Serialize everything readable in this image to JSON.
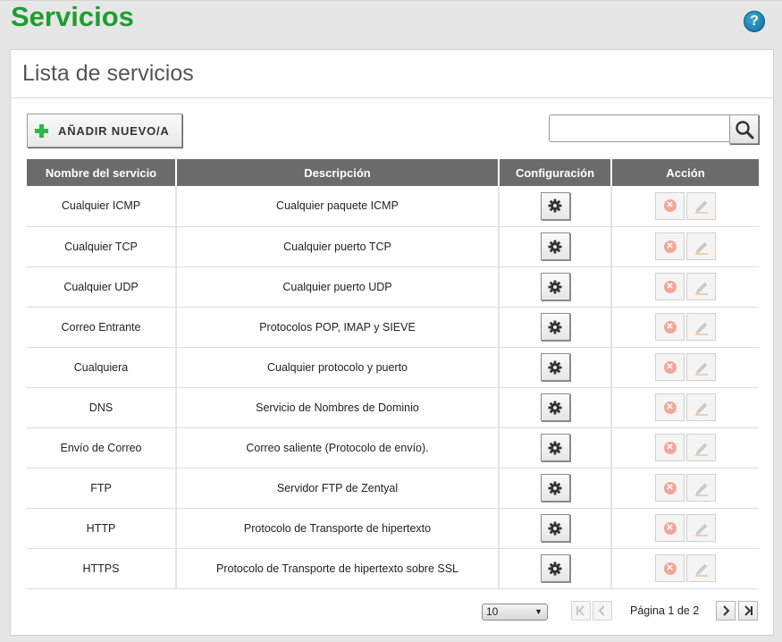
{
  "page": {
    "title": "Servicios"
  },
  "panel": {
    "title": "Lista de servicios"
  },
  "toolbar": {
    "add_label": "AÑADIR NUEVO/A",
    "search_value": ""
  },
  "table": {
    "headers": [
      "Nombre del servicio",
      "Descripción",
      "Configuración",
      "Acción"
    ],
    "rows": [
      {
        "name": "Cualquier ICMP",
        "description": "Cualquier paquete ICMP"
      },
      {
        "name": "Cualquier TCP",
        "description": "Cualquier puerto TCP"
      },
      {
        "name": "Cualquier UDP",
        "description": "Cualquier puerto UDP"
      },
      {
        "name": "Correo Entrante",
        "description": "Protocolos POP, IMAP y SIEVE"
      },
      {
        "name": "Cualquiera",
        "description": "Cualquier protocolo y puerto"
      },
      {
        "name": "DNS",
        "description": "Servicio de Nombres de Dominio"
      },
      {
        "name": "Envío de Correo",
        "description": "Correo saliente (Protocolo de envío)."
      },
      {
        "name": "FTP",
        "description": "Servidor FTP de Zentyal"
      },
      {
        "name": "HTTP",
        "description": "Protocolo de Transporte de hipertexto"
      },
      {
        "name": "HTTPS",
        "description": "Protocolo de Transporte de hipertexto sobre SSL"
      }
    ]
  },
  "pager": {
    "page_size": "10",
    "page_label": "Página 1 de 2"
  },
  "icons": {
    "help": "help-icon",
    "add": "plus-icon",
    "search": "search-icon",
    "configure": "gear-icon",
    "delete": "delete-icon",
    "edit": "pencil-icon",
    "first": "first-page-icon",
    "prev": "prev-page-icon",
    "next": "next-page-icon",
    "last": "last-page-icon"
  },
  "colors": {
    "title": "#1e9e2e",
    "header_bg": "#6b6b6b",
    "add": "#2db44a",
    "delete": "#f0a69a",
    "help": "#0f6d9c"
  }
}
